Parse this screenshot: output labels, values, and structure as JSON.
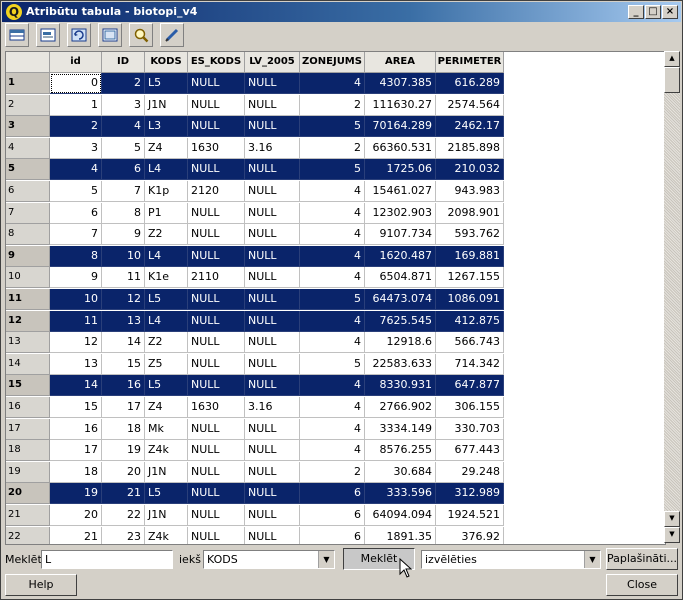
{
  "window": {
    "title": "Atribūtu tabula - biotopi_v4",
    "app_icon": "Q"
  },
  "title_buttons": [
    "_",
    "□",
    "×"
  ],
  "toolbar": [
    "table-icon",
    "table-select-icon",
    "refresh-icon",
    "invert-icon",
    "zoom-icon",
    "edit-pencil-icon"
  ],
  "table": {
    "columns": [
      "id",
      "ID",
      "KODS",
      "ES_KODS",
      "LV_2005",
      "ZONEJUMS",
      "AREA",
      "PERIMETER"
    ],
    "rows": [
      {
        "n": "1",
        "sel": true,
        "c": [
          "0",
          "2",
          "L5",
          "NULL",
          "NULL",
          "4",
          "4307.385",
          "616.289"
        ]
      },
      {
        "n": "2",
        "sel": false,
        "c": [
          "1",
          "3",
          "J1N",
          "NULL",
          "NULL",
          "2",
          "111630.27",
          "2574.564"
        ]
      },
      {
        "n": "3",
        "sel": true,
        "c": [
          "2",
          "4",
          "L3",
          "NULL",
          "NULL",
          "5",
          "70164.289",
          "2462.17"
        ]
      },
      {
        "n": "4",
        "sel": false,
        "c": [
          "3",
          "5",
          "Z4",
          "1630",
          "3.16",
          "2",
          "66360.531",
          "2185.898"
        ]
      },
      {
        "n": "5",
        "sel": true,
        "c": [
          "4",
          "6",
          "L4",
          "NULL",
          "NULL",
          "5",
          "1725.06",
          "210.032"
        ]
      },
      {
        "n": "6",
        "sel": false,
        "c": [
          "5",
          "7",
          "K1p",
          "2120",
          "NULL",
          "4",
          "15461.027",
          "943.983"
        ]
      },
      {
        "n": "7",
        "sel": false,
        "c": [
          "6",
          "8",
          "P1",
          "NULL",
          "NULL",
          "4",
          "12302.903",
          "2098.901"
        ]
      },
      {
        "n": "8",
        "sel": false,
        "c": [
          "7",
          "9",
          "Z2",
          "NULL",
          "NULL",
          "4",
          "9107.734",
          "593.762"
        ]
      },
      {
        "n": "9",
        "sel": true,
        "c": [
          "8",
          "10",
          "L4",
          "NULL",
          "NULL",
          "4",
          "1620.487",
          "169.881"
        ]
      },
      {
        "n": "10",
        "sel": false,
        "c": [
          "9",
          "11",
          "K1e",
          "2110",
          "NULL",
          "4",
          "6504.871",
          "1267.155"
        ]
      },
      {
        "n": "11",
        "sel": true,
        "c": [
          "10",
          "12",
          "L5",
          "NULL",
          "NULL",
          "5",
          "64473.074",
          "1086.091"
        ]
      },
      {
        "n": "12",
        "sel": true,
        "c": [
          "11",
          "13",
          "L4",
          "NULL",
          "NULL",
          "4",
          "7625.545",
          "412.875"
        ]
      },
      {
        "n": "13",
        "sel": false,
        "c": [
          "12",
          "14",
          "Z2",
          "NULL",
          "NULL",
          "4",
          "12918.6",
          "566.743"
        ]
      },
      {
        "n": "14",
        "sel": false,
        "c": [
          "13",
          "15",
          "Z5",
          "NULL",
          "NULL",
          "5",
          "22583.633",
          "714.342"
        ]
      },
      {
        "n": "15",
        "sel": true,
        "c": [
          "14",
          "16",
          "L5",
          "NULL",
          "NULL",
          "4",
          "8330.931",
          "647.877"
        ]
      },
      {
        "n": "16",
        "sel": false,
        "c": [
          "15",
          "17",
          "Z4",
          "1630",
          "3.16",
          "4",
          "2766.902",
          "306.155"
        ]
      },
      {
        "n": "17",
        "sel": false,
        "c": [
          "16",
          "18",
          "Mk",
          "NULL",
          "NULL",
          "4",
          "3334.149",
          "330.703"
        ]
      },
      {
        "n": "18",
        "sel": false,
        "c": [
          "17",
          "19",
          "Z4k",
          "NULL",
          "NULL",
          "4",
          "8576.255",
          "677.443"
        ]
      },
      {
        "n": "19",
        "sel": false,
        "c": [
          "18",
          "20",
          "J1N",
          "NULL",
          "NULL",
          "2",
          "30.684",
          "29.248"
        ]
      },
      {
        "n": "20",
        "sel": true,
        "c": [
          "19",
          "21",
          "L5",
          "NULL",
          "NULL",
          "6",
          "333.596",
          "312.989"
        ]
      },
      {
        "n": "21",
        "sel": false,
        "c": [
          "20",
          "22",
          "J1N",
          "NULL",
          "NULL",
          "6",
          "64094.094",
          "1924.521"
        ]
      },
      {
        "n": "22",
        "sel": false,
        "c": [
          "21",
          "23",
          "Z4k",
          "NULL",
          "NULL",
          "6",
          "1891.35",
          "376.92"
        ]
      }
    ]
  },
  "search": {
    "label": "Meklēt",
    "value": "L",
    "in_label": "iekš",
    "field": "KODS",
    "button": "Meklēt",
    "mode": "izvēlēties",
    "advanced": "Paplašināti...",
    "help": "Help",
    "close": "Close"
  }
}
